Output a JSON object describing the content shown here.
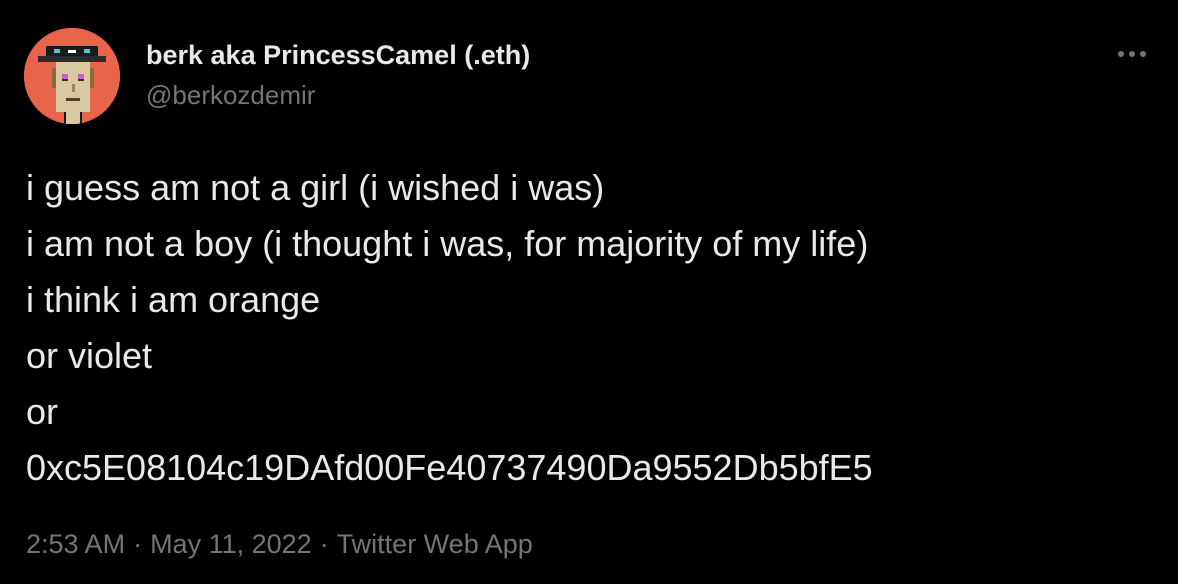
{
  "author": {
    "display_name": "berk aka PrincessCamel (.eth)",
    "handle": "@berkozdemir",
    "avatar_icon": "pixel-art-avatar-icon",
    "avatar_bg": "#e8644a"
  },
  "menu": {
    "icon": "more-horizontal-icon"
  },
  "tweet": {
    "lines": [
      "i guess am not a girl (i wished i was)",
      "i am not a boy (i thought i was, for majority of my life)",
      "i think i am orange",
      "or violet",
      "or",
      "0xc5E08104c19DAfd00Fe40737490Da9552Db5bfE5"
    ]
  },
  "meta": {
    "time": "2:53 AM",
    "date": "May 11, 2022",
    "source": "Twitter Web App",
    "separator": "·"
  },
  "colors": {
    "background": "#000000",
    "primary_text": "#e7e9ea",
    "secondary_text": "#71767b"
  }
}
